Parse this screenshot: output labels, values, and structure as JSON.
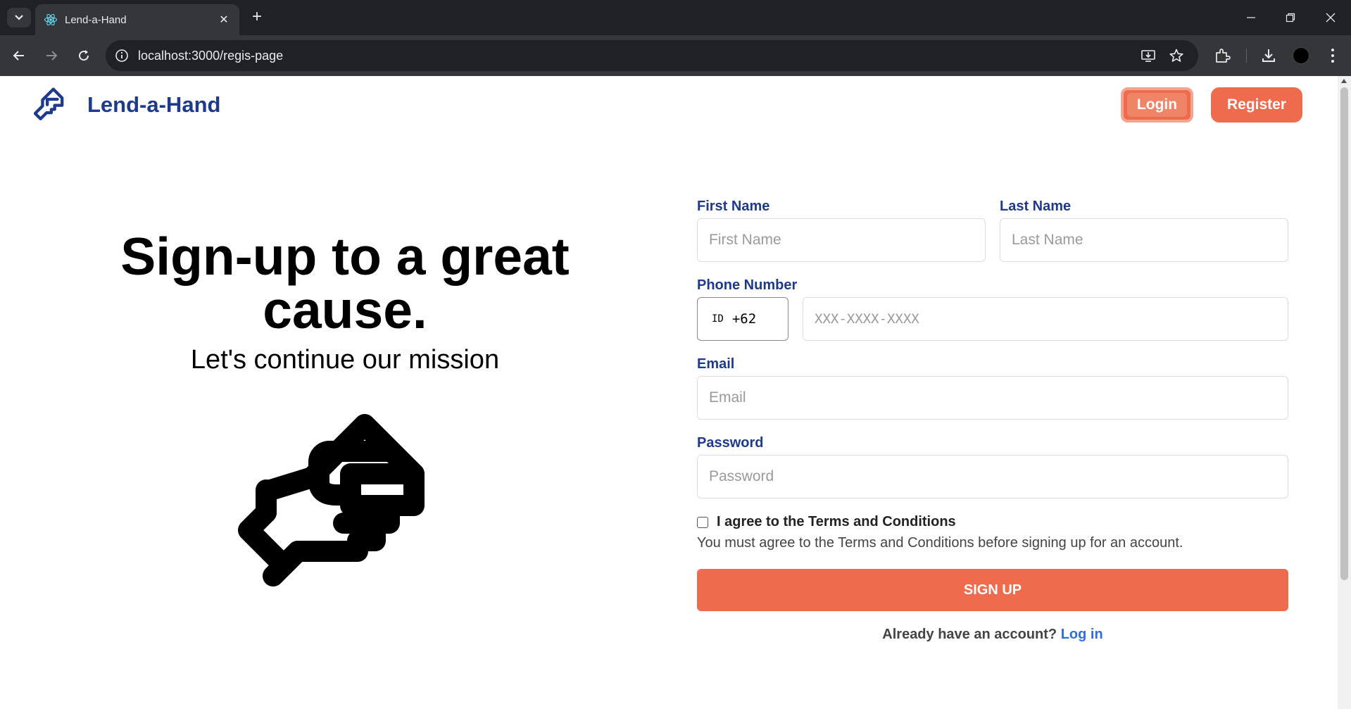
{
  "browser": {
    "tab_title": "Lend-a-Hand",
    "url": "localhost:3000/regis-page",
    "new_tab_label": "+",
    "tab_close_label": "✕"
  },
  "icons": [
    "tab-search-icon",
    "react-favicon-icon",
    "close-icon",
    "plus-icon",
    "minimize-icon",
    "restore-icon",
    "back-icon",
    "forward-icon",
    "reload-icon",
    "info-icon",
    "install-app-icon",
    "star-icon",
    "extensions-icon",
    "download-icon",
    "profile-icon",
    "menu-icon",
    "lend-a-hand-logo-icon",
    "handshake-illustration-icon",
    "checkbox-icon"
  ],
  "colors": {
    "brand_blue": "#1e3a8a",
    "accent_orange": "#ee6b4d",
    "link_blue": "#2f6fdb",
    "chrome_dark": "#202124",
    "chrome_toolbar": "#35363a"
  },
  "header": {
    "brand_name": "Lend-a-Hand",
    "login_label": "Login",
    "register_label": "Register"
  },
  "hero": {
    "title": "Sign-up to a great cause.",
    "subtitle": "Let's continue our mission"
  },
  "form": {
    "first_name": {
      "label": "First Name",
      "placeholder": "First Name",
      "value": ""
    },
    "last_name": {
      "label": "Last Name",
      "placeholder": "Last Name",
      "value": ""
    },
    "phone": {
      "label": "Phone Number",
      "country_code": "ID",
      "dial_code": "+62",
      "placeholder": "XXX-XXXX-XXXX",
      "value": ""
    },
    "email": {
      "label": "Email",
      "placeholder": "Email",
      "value": ""
    },
    "password": {
      "label": "Password",
      "placeholder": "Password",
      "value": ""
    },
    "agree_label": "I agree to the Terms and Conditions",
    "agree_checked": false,
    "agree_hint": "You must agree to the Terms and Conditions before signing up for an account.",
    "submit_label": "SIGN UP",
    "have_account_text": "Already have an account?",
    "login_link_label": "Log in"
  }
}
